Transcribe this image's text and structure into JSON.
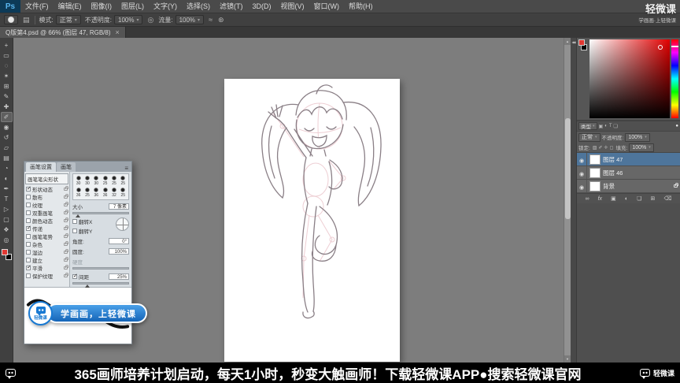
{
  "colors": {
    "accent": "#1879d2",
    "selection": "#4e759b",
    "fg_swatch": "#e13832"
  },
  "menu_bar": {
    "logo": "Ps",
    "items": [
      "文件(F)",
      "编辑(E)",
      "图像(I)",
      "图层(L)",
      "文字(Y)",
      "选择(S)",
      "滤镜(T)",
      "3D(D)",
      "视图(V)",
      "窗口(W)",
      "帮助(H)"
    ]
  },
  "options_bar": {
    "mode_label": "模式:",
    "mode_value": "正常",
    "opacity_label": "不透明度:",
    "opacity_value": "100%",
    "flow_label": "流量:",
    "flow_value": "100%"
  },
  "document_tab": {
    "title": "Q版第4.psd @ 66% (图层 47, RGB/8)",
    "close_label": "×"
  },
  "toolbar": {
    "tools": [
      {
        "name": "move-tool",
        "glyph": "+"
      },
      {
        "name": "rectangular-marquee-tool",
        "glyph": "▭"
      },
      {
        "name": "lasso-tool",
        "glyph": "◌"
      },
      {
        "name": "magic-wand-tool",
        "glyph": "✶"
      },
      {
        "name": "crop-tool",
        "glyph": "⊞"
      },
      {
        "name": "eyedropper-tool",
        "glyph": "✎"
      },
      {
        "name": "healing-brush-tool",
        "glyph": "✚"
      },
      {
        "name": "brush-tool",
        "glyph": "✐",
        "selected": true
      },
      {
        "name": "clone-stamp-tool",
        "glyph": "◉"
      },
      {
        "name": "history-brush-tool",
        "glyph": "↺"
      },
      {
        "name": "eraser-tool",
        "glyph": "▱"
      },
      {
        "name": "gradient-tool",
        "glyph": "▤"
      },
      {
        "name": "blur-tool",
        "glyph": "◔"
      },
      {
        "name": "dodge-tool",
        "glyph": "◐"
      },
      {
        "name": "pen-tool",
        "glyph": "✒"
      },
      {
        "name": "type-tool",
        "glyph": "T"
      },
      {
        "name": "path-selection-tool",
        "glyph": "▷"
      },
      {
        "name": "shape-tool",
        "glyph": "▢"
      },
      {
        "name": "hand-tool",
        "glyph": "❖"
      },
      {
        "name": "zoom-tool",
        "glyph": "◎"
      }
    ]
  },
  "brush_panel": {
    "tabs": [
      {
        "label": "画笔设置",
        "active": true
      },
      {
        "label": "画笔",
        "active": false
      }
    ],
    "menu_icon": "≡",
    "tip_shape_label": "画笔笔尖形状",
    "options": [
      {
        "label": "形状动态",
        "checked": true
      },
      {
        "label": "散布",
        "checked": false
      },
      {
        "label": "纹理",
        "checked": false
      },
      {
        "label": "双重画笔",
        "checked": false
      },
      {
        "label": "颜色动态",
        "checked": false
      },
      {
        "label": "传递",
        "checked": true
      },
      {
        "label": "画笔笔势",
        "checked": false
      },
      {
        "label": "杂色",
        "checked": false
      },
      {
        "label": "湿边",
        "checked": false
      },
      {
        "label": "建立",
        "checked": false
      },
      {
        "label": "平滑",
        "checked": true
      },
      {
        "label": "保护纹理",
        "checked": false
      }
    ],
    "tips": [
      {
        "size": "30"
      },
      {
        "size": "30"
      },
      {
        "size": "30"
      },
      {
        "size": "25"
      },
      {
        "size": "25"
      },
      {
        "size": "25"
      },
      {
        "size": "36"
      },
      {
        "size": "25"
      },
      {
        "size": "36"
      },
      {
        "size": "36"
      },
      {
        "size": "32"
      },
      {
        "size": "25"
      }
    ],
    "size_label": "大小",
    "size_value": "7 像素",
    "flip_x_label": "翻转X",
    "flip_y_label": "翻转Y",
    "angle_label": "角度:",
    "angle_value": "0°",
    "roundness_label": "圆度:",
    "roundness_value": "100%",
    "hardness_label": "硬度",
    "spacing_label": "间距",
    "spacing_value": "25%"
  },
  "layers_panel": {
    "filter_label": "类型",
    "filter_icons": [
      {
        "name": "filter-image-icon",
        "glyph": "▣"
      },
      {
        "name": "filter-adjustment-icon",
        "glyph": "◐"
      },
      {
        "name": "filter-type-icon",
        "glyph": "T"
      },
      {
        "name": "filter-shape-icon",
        "glyph": "❏"
      }
    ],
    "filter_toggle_glyph": "●",
    "blend_mode": "正常",
    "opacity_label": "不透明度:",
    "opacity_value": "100%",
    "lock_label": "锁定:",
    "lock_icons": [
      {
        "name": "lock-transparency-icon",
        "glyph": "▨"
      },
      {
        "name": "lock-pixels-icon",
        "glyph": "✐"
      },
      {
        "name": "lock-position-icon",
        "glyph": "✛"
      },
      {
        "name": "lock-all-icon",
        "glyph": "◻"
      }
    ],
    "fill_label": "填充:",
    "fill_value": "100%",
    "layers": [
      {
        "name": "图层 47",
        "selected": true,
        "locked": false
      },
      {
        "name": "图层 46",
        "selected": false,
        "locked": false
      },
      {
        "name": "背景",
        "selected": false,
        "locked": true
      }
    ],
    "footer_icons": [
      {
        "name": "link-layers-icon",
        "glyph": "∞"
      },
      {
        "name": "layer-style-icon",
        "glyph": "fx"
      },
      {
        "name": "layer-mask-icon",
        "glyph": "▣"
      },
      {
        "name": "adjustment-layer-icon",
        "glyph": "◐"
      },
      {
        "name": "layer-group-icon",
        "glyph": "❏"
      },
      {
        "name": "new-layer-icon",
        "glyph": "⊞"
      },
      {
        "name": "delete-layer-icon",
        "glyph": "⌫"
      }
    ]
  },
  "watermark": {
    "title": "轻微课",
    "subtitle": "学画画·上轻微课"
  },
  "badge": {
    "text": "学画画，上轻微课",
    "logo_text": "轻微课"
  },
  "bottom_bar": {
    "text": "365画师培养计划启动，每天1小时，秒变大触画师！下载轻微课APP●搜索轻微课官网",
    "brand": "轻微课"
  }
}
